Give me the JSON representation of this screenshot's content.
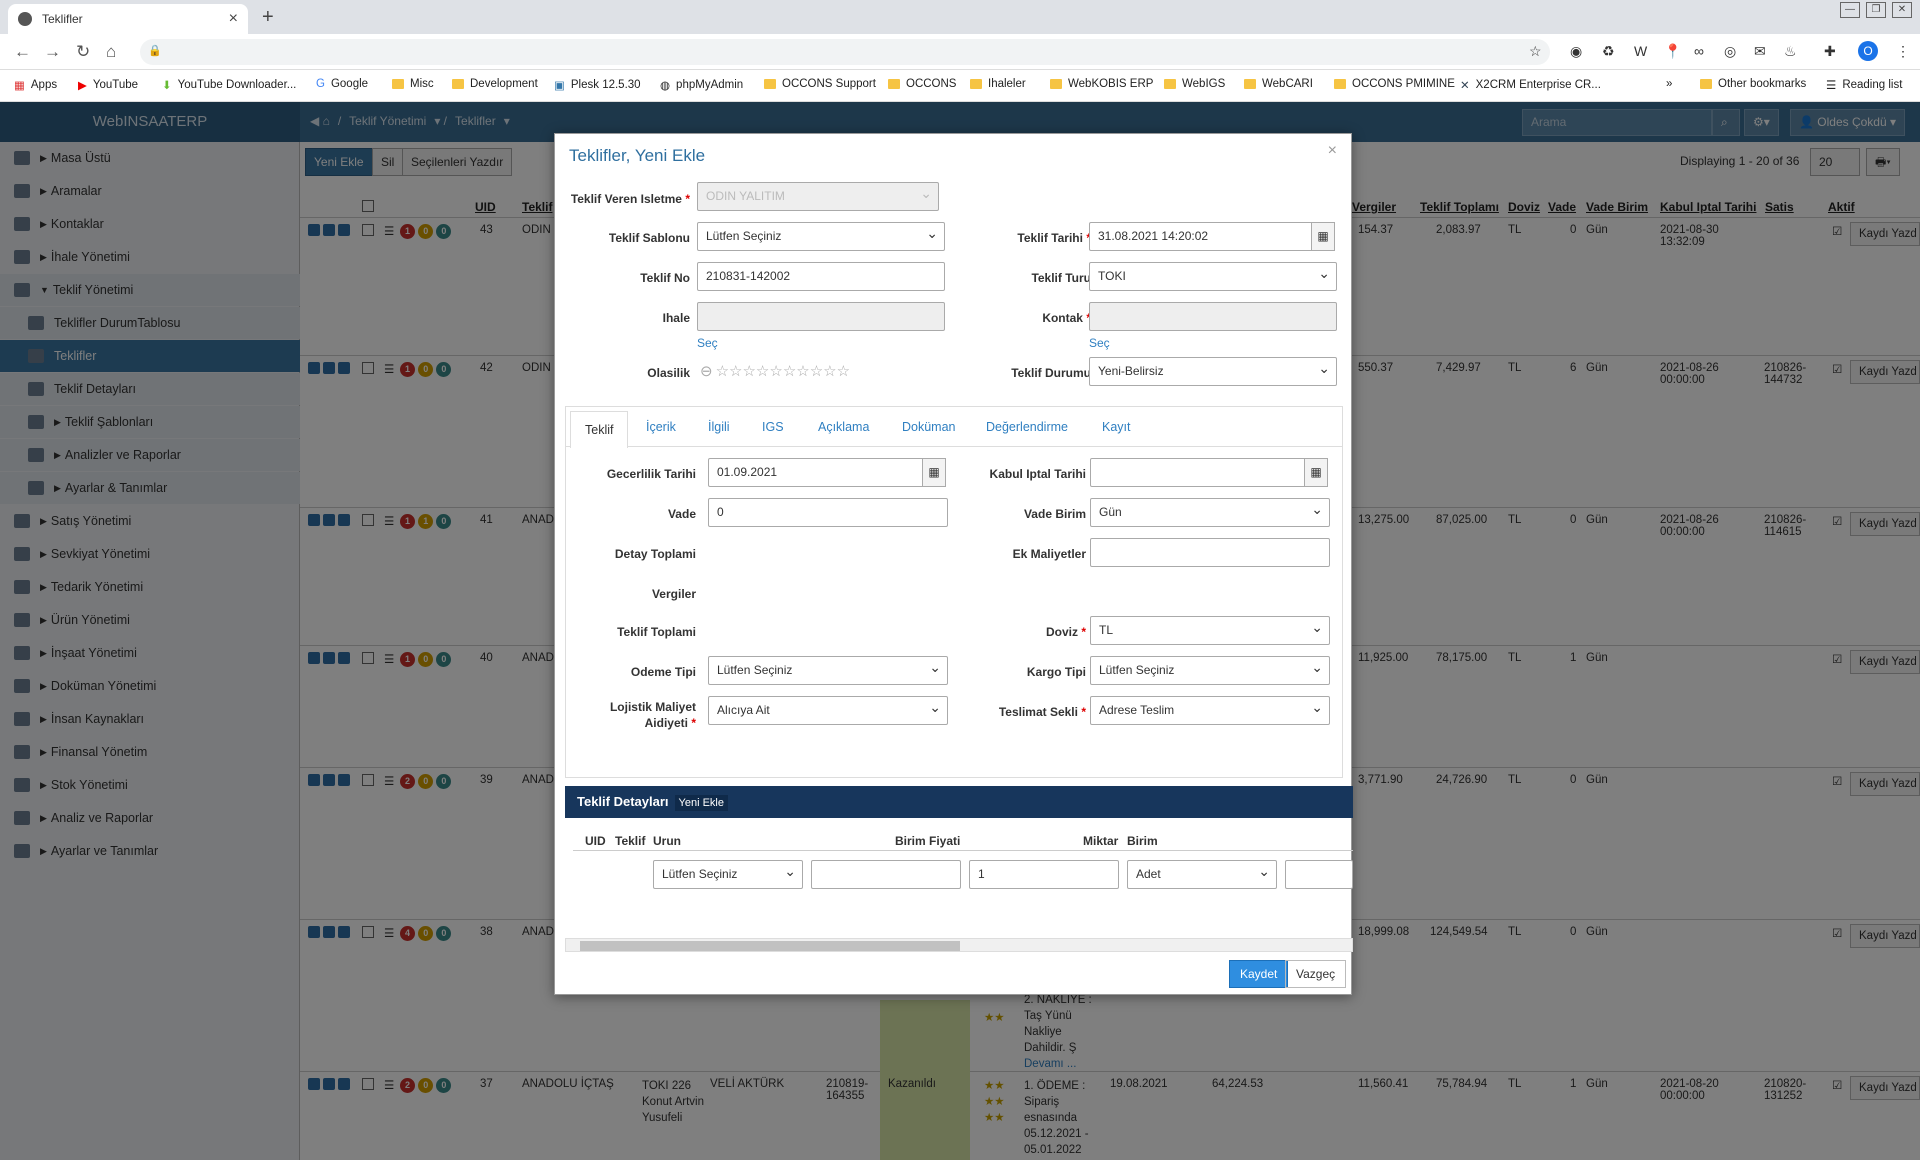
{
  "browser": {
    "tab_title": "Teklifler",
    "tab_close": "×",
    "new_tab": "+",
    "win_controls": [
      "—",
      "❐",
      "✕"
    ],
    "nav": [
      "←",
      "→",
      "↻",
      "⌂",
      "🔒"
    ],
    "ext_icons": [
      "☆",
      "◉",
      "♻",
      "W",
      "📍",
      "∞",
      "◎",
      "✉",
      "♨",
      "✚",
      "O",
      "⋮"
    ]
  },
  "bookmarks": [
    "Apps",
    "YouTube",
    "YouTube Downloader...",
    "Google",
    "Misc",
    "Development",
    "Plesk 12.5.30",
    "phpMyAdmin",
    "OCCONS Support",
    "OCCONS",
    "Ihaleler",
    "WebKOBIS ERP",
    "WebIGS",
    "WebCARI",
    "OCCONS PMIMINE",
    "X2CRM Enterprise CR...",
    "»",
    "Other bookmarks",
    "Reading list"
  ],
  "app": {
    "brand": "WebINSAATERP",
    "crumbs": [
      "Teklif Yönetimi",
      "Teklifler"
    ],
    "search_placeholder": "Arama",
    "user": "Oldes Çokdü"
  },
  "sidebar": [
    {
      "label": "Masa Üstü",
      "level": 0
    },
    {
      "label": "Aramalar",
      "level": 0
    },
    {
      "label": "Kontaklar",
      "level": 0
    },
    {
      "label": "İhale Yönetimi",
      "level": 0
    },
    {
      "label": "Teklif Yönetimi",
      "level": 0,
      "open": true
    },
    {
      "label": "Teklifler DurumTablosu",
      "level": 1
    },
    {
      "label": "Teklifler",
      "level": 1,
      "active": true
    },
    {
      "label": "Teklif Detayları",
      "level": 1
    },
    {
      "label": "Teklif Şablonları",
      "level": 1
    },
    {
      "label": "Analizler ve Raporlar",
      "level": 1
    },
    {
      "label": "Ayarlar & Tanımlar",
      "level": 1
    },
    {
      "label": "Satış Yönetimi",
      "level": 0
    },
    {
      "label": "Sevkiyat Yönetimi",
      "level": 0
    },
    {
      "label": "Tedarik Yönetimi",
      "level": 0
    },
    {
      "label": "Ürün Yönetimi",
      "level": 0
    },
    {
      "label": "İnşaat Yönetimi",
      "level": 0
    },
    {
      "label": "Doküman Yönetimi",
      "level": 0
    },
    {
      "label": "İnsan Kaynakları",
      "level": 0
    },
    {
      "label": "Finansal Yönetim",
      "level": 0
    },
    {
      "label": "Stok Yönetimi",
      "level": 0
    },
    {
      "label": "Analiz ve Raporlar",
      "level": 0
    },
    {
      "label": "Ayarlar ve Tanımlar",
      "level": 0
    }
  ],
  "toolbar": {
    "new": "Yeni Ekle",
    "delete": "Sil",
    "print": "Seçilenleri Yazdır",
    "display": "Displaying 1 - 20 of 36",
    "page_size": "20"
  },
  "grid": {
    "headers": [
      "UID",
      "Teklif",
      "Vergiler",
      "Teklif Toplamı",
      "Doviz",
      "Vade",
      "Vade Birim",
      "Kabul Iptal Tarihi",
      "Satis",
      "Aktif"
    ],
    "rows": [
      {
        "uid": "43",
        "name": "ODIN",
        "b": [
          "1",
          "0",
          "0"
        ],
        "vergi": "154.37",
        "toplam": "2,083.97",
        "doviz": "TL",
        "vade": "0",
        "birim": "Gün",
        "kabul": "2021-08-30 13:32:09",
        "satis": ""
      },
      {
        "uid": "42",
        "name": "ODIN",
        "b": [
          "1",
          "0",
          "0"
        ],
        "vergi": "550.37",
        "toplam": "7,429.97",
        "doviz": "TL",
        "vade": "6",
        "birim": "Gün",
        "kabul": "2021-08-26 00:00:00",
        "satis": "210826-144732"
      },
      {
        "uid": "41",
        "name": "ANAD",
        "b": [
          "1",
          "1",
          "0"
        ],
        "vergi": "13,275.00",
        "toplam": "87,025.00",
        "doviz": "TL",
        "vade": "0",
        "birim": "Gün",
        "kabul": "2021-08-26 00:00:00",
        "satis": "210826-114615"
      },
      {
        "uid": "40",
        "name": "ANAD",
        "b": [
          "1",
          "0",
          "0"
        ],
        "vergi": "11,925.00",
        "toplam": "78,175.00",
        "doviz": "TL",
        "vade": "1",
        "birim": "Gün",
        "kabul": "",
        "satis": ""
      },
      {
        "uid": "39",
        "name": "ANAD",
        "b": [
          "2",
          "0",
          "0"
        ],
        "vergi": "3,771.90",
        "toplam": "24,726.90",
        "doviz": "TL",
        "vade": "0",
        "birim": "Gün",
        "kabul": "",
        "satis": ""
      },
      {
        "uid": "38",
        "name": "ANAD",
        "b": [
          "4",
          "0",
          "0"
        ],
        "vergi": "18,999.08",
        "toplam": "124,549.54",
        "doviz": "TL",
        "vade": "0",
        "birim": "Gün",
        "kabul": "",
        "satis": ""
      },
      {
        "uid": "37",
        "name": "ANADOLU İÇTAŞ",
        "b": [
          "2",
          "0",
          "0"
        ],
        "vergi": "11,560.41",
        "toplam": "75,784.94",
        "doviz": "TL",
        "vade": "1",
        "birim": "Gün",
        "kabul": "2021-08-20 00:00:00",
        "satis": "210820-131252"
      }
    ],
    "kayit": "Kaydı Yazd",
    "row38_note": [
      "2. NAKLİYE :",
      "Taş Yünü",
      "Nakliye",
      "Dahildir. Ş",
      "Devamı ..."
    ],
    "row37_extra": {
      "proje": "TOKI 226 Konut Artvin Yusufeli",
      "kontak": "VELİ AKTÜRK",
      "no": "210819-164355",
      "durum": "Kazanıldı",
      "note": [
        "1. ÖDEME :",
        "Sipariş",
        "esnasında",
        "05.12.2021 -",
        "05.01.2022"
      ],
      "tarih": "19.08.2021",
      "tutar": "64,224.53"
    }
  },
  "modal": {
    "title": "Teklifler, Yeni Ekle",
    "close": "×",
    "firm_label": "Teklif Veren Isletme",
    "firm_value": "ODIN YALITIM",
    "sablon_label": "Teklif Sablonu",
    "sablon_value": "Lütfen Seçiniz",
    "tarih_label": "Teklif Tarihi",
    "tarih_value": "31.08.2021 14:20:02",
    "no_label": "Teklif No",
    "no_value": "210831-142002",
    "turu_label": "Teklif Turu",
    "turu_value": "TOKI",
    "ihale_label": "Ihale",
    "kontak_label": "Kontak",
    "sec": "Seç",
    "olasilik_label": "Olasilik",
    "durum_label": "Teklif Durumu",
    "durum_value": "Yeni-Belirsiz",
    "tabs": [
      "Teklif",
      "İçerik",
      "İlgili",
      "IGS",
      "Açıklama",
      "Doküman",
      "Değerlendirme",
      "Kayıt"
    ],
    "gecerlilik_label": "Gecerlilik Tarihi",
    "gecerlilik_value": "01.09.2021",
    "kabul_label": "Kabul Iptal Tarihi",
    "vade_label": "Vade",
    "vade_value": "0",
    "vadebirim_label": "Vade Birim",
    "vadebirim_value": "Gün",
    "detay_label": "Detay Toplami",
    "ek_label": "Ek Maliyetler",
    "vergiler_label": "Vergiler",
    "toplam_label": "Teklif Toplami",
    "doviz_label": "Doviz",
    "doviz_value": "TL",
    "odeme_label": "Odeme Tipi",
    "odeme_value": "Lütfen Seçiniz",
    "kargo_label": "Kargo Tipi",
    "kargo_value": "Lütfen Seçiniz",
    "lojistik_label": "Lojistik Maliyet Aidiyeti",
    "lojistik_value": "Alıcıya Ait",
    "teslimat_label": "Teslimat Sekli",
    "teslimat_value": "Adrese Teslim",
    "detay_title": "Teklif Detayları",
    "detay_new": "Yeni Ekle",
    "dcols": [
      "UID",
      "Teklif",
      "Urun",
      "Birim Fiyati",
      "Miktar",
      "Birim"
    ],
    "d_urun": "Lütfen Seçiniz",
    "d_miktar": "1",
    "d_birim": "Adet",
    "save": "Kaydet",
    "cancel": "Vazgeç"
  },
  "colors": {
    "header": "#3b6f95",
    "active": "#3a76a3",
    "detail_bar": "#17365c",
    "primary_btn": "#2f8ee0"
  }
}
